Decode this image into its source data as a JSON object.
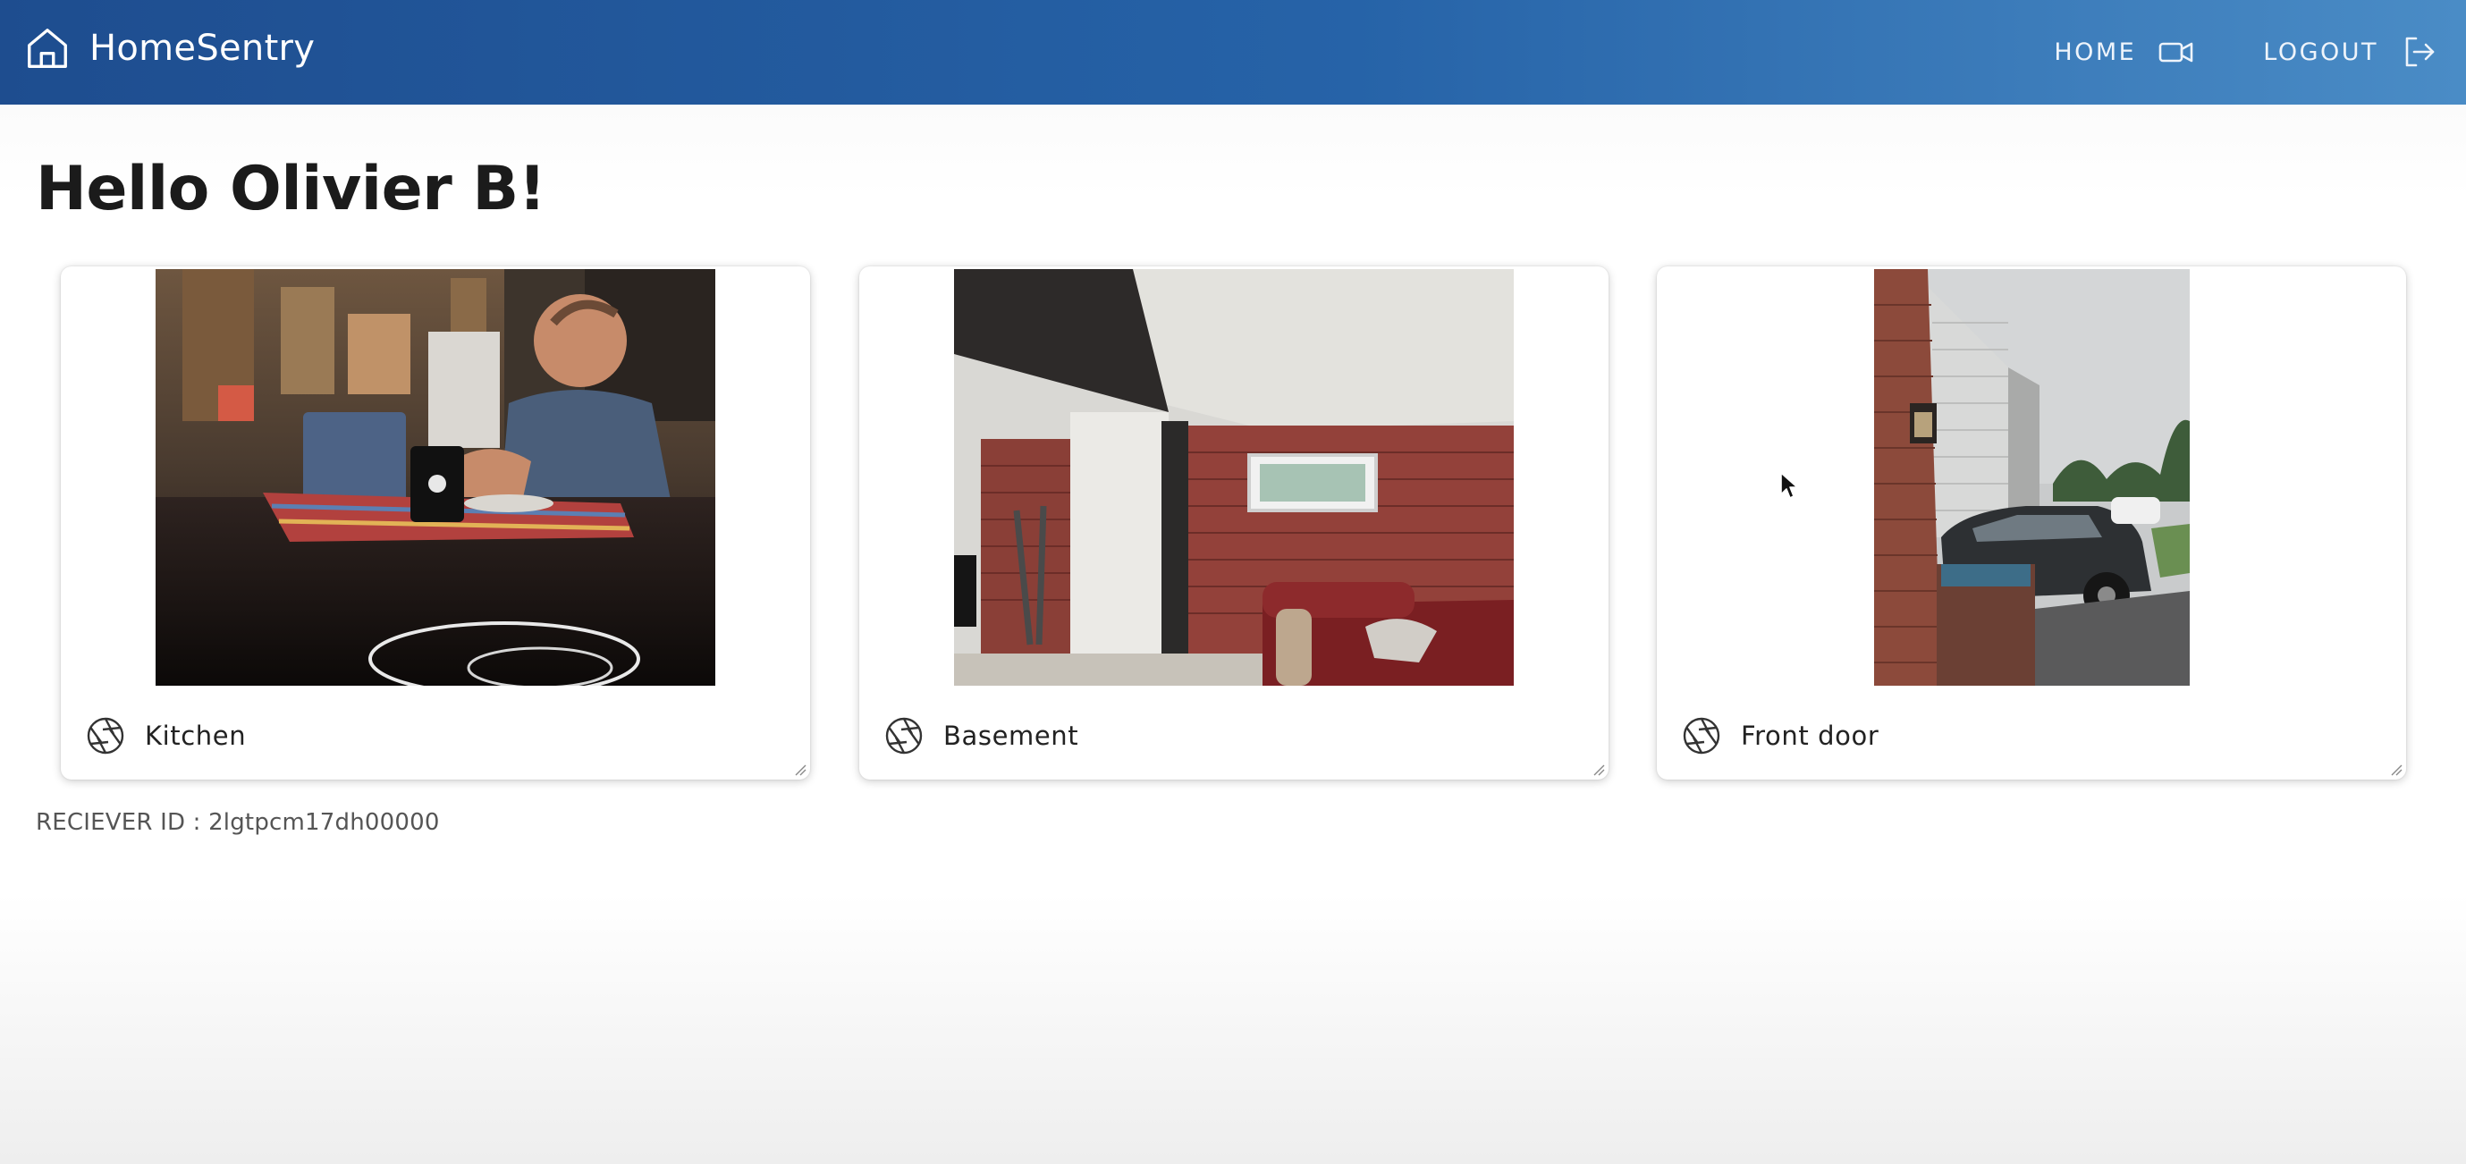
{
  "header": {
    "brand": "HomeSentry",
    "brand_icon": "home-icon",
    "nav": [
      {
        "label": "HOME",
        "icon": "video-camera-icon"
      },
      {
        "label": "LOGOUT",
        "icon": "logout-icon"
      }
    ]
  },
  "greeting": "Hello Olivier B!",
  "cameras": [
    {
      "name": "Kitchen",
      "icon": "aperture-icon"
    },
    {
      "name": "Basement",
      "icon": "aperture-icon"
    },
    {
      "name": "Front door",
      "icon": "aperture-icon"
    }
  ],
  "receiver": "RECIEVER ID : 2lgtpcm17dh00000",
  "colors": {
    "header_start": "#1e4d8f",
    "header_end": "#4a8cc6",
    "text": "#1b1b1b",
    "muted": "#555555"
  }
}
